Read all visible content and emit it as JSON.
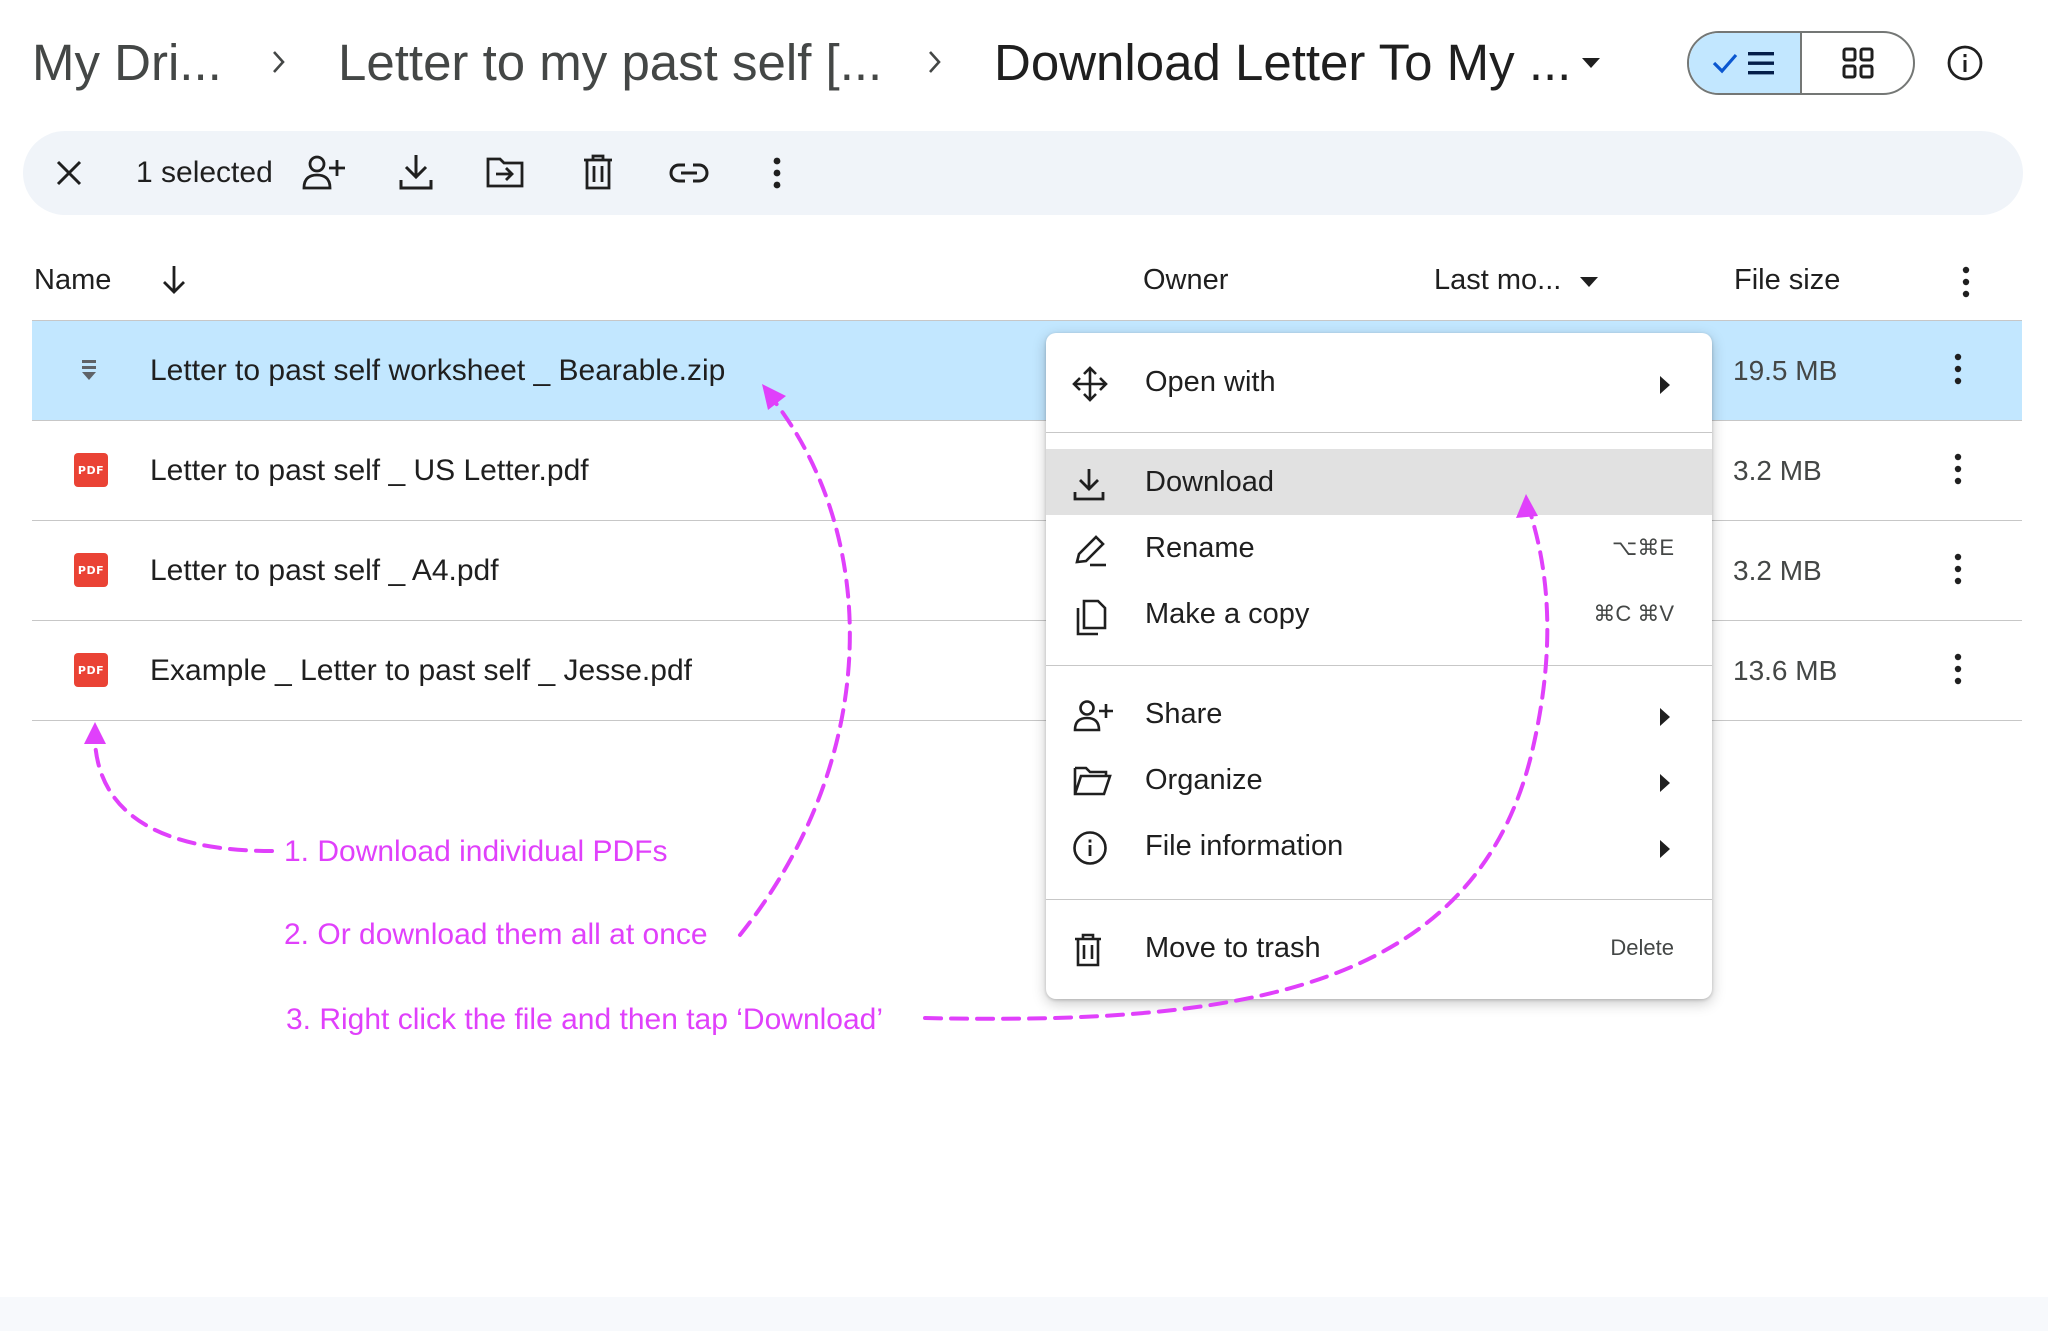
{
  "breadcrumb": {
    "items": [
      "My Dri...",
      "Letter to my past self [...",
      "Download Letter To My ..."
    ]
  },
  "view_toggle": {
    "list_icon": "check-list-icon",
    "grid_icon": "grid-icon",
    "info_icon": "info-icon"
  },
  "selection_bar": {
    "count_label": "1 selected",
    "actions": [
      "close-icon",
      "share-person-add-icon",
      "download-icon",
      "move-to-folder-icon",
      "trash-icon",
      "link-icon",
      "more-vert-icon"
    ]
  },
  "table": {
    "columns": {
      "name": "Name",
      "owner": "Owner",
      "last_modified": "Last mo...",
      "file_size": "File size"
    },
    "rows": [
      {
        "name": "Letter to past self worksheet _ Bearable.zip",
        "size": "19.5 MB",
        "type": "zip",
        "selected": true
      },
      {
        "name": "Letter to past self _ US Letter.pdf",
        "size": "3.2 MB",
        "type": "pdf",
        "badge": "PDF"
      },
      {
        "name": "Letter to past self _ A4.pdf",
        "size": "3.2 MB",
        "type": "pdf",
        "badge": "PDF"
      },
      {
        "name": "Example _ Letter to past self _ Jesse.pdf",
        "size": "13.6 MB",
        "type": "pdf",
        "badge": "PDF"
      }
    ]
  },
  "context_menu": {
    "items": [
      {
        "label": "Open with",
        "icon": "open-with-icon",
        "submenu": true
      },
      {
        "label": "Download",
        "icon": "download-icon",
        "highlighted": true
      },
      {
        "label": "Rename",
        "icon": "rename-icon",
        "shortcut": "⌥⌘E"
      },
      {
        "label": "Make a copy",
        "icon": "copy-icon",
        "shortcut": "⌘C ⌘V"
      },
      {
        "label": "Share",
        "icon": "share-person-add-icon",
        "submenu": true
      },
      {
        "label": "Organize",
        "icon": "folder-icon",
        "submenu": true
      },
      {
        "label": "File information",
        "icon": "info-icon",
        "submenu": true
      },
      {
        "label": "Move to trash",
        "icon": "trash-icon",
        "shortcut": "Delete"
      }
    ]
  },
  "annotations": {
    "color": "#e040fb",
    "steps": [
      "1. Download individual PDFs",
      "2. Or download them all at once",
      "3. Right click the file and then tap ‘Download’"
    ]
  },
  "colors": {
    "selected_row": "#c2e7ff",
    "selection_bar": "#f0f4f9",
    "menu_highlight": "#e1e1e1",
    "pdf_red": "#ea4335"
  }
}
